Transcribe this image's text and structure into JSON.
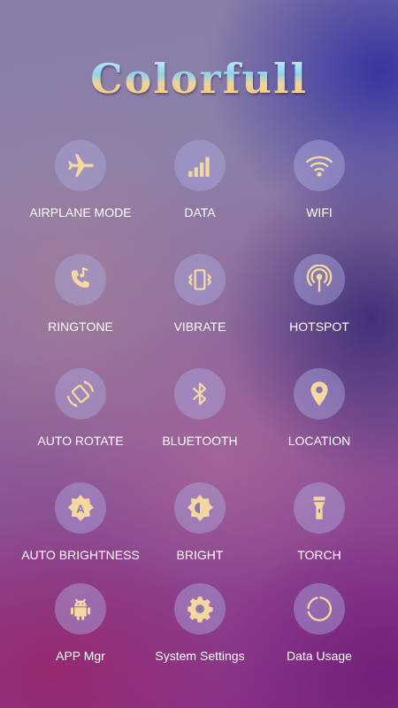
{
  "title": "Colorfull",
  "colors": {
    "icon": "#f5d7a1",
    "circle": "rgba(170,170,225,0.45)",
    "label": "#ffffff"
  },
  "tiles": [
    {
      "label": "AIRPLANE MODE",
      "icon": "airplane-icon"
    },
    {
      "label": "DATA",
      "icon": "signal-bars-icon"
    },
    {
      "label": "WIFI",
      "icon": "wifi-icon"
    },
    {
      "label": "RINGTONE",
      "icon": "ringtone-icon"
    },
    {
      "label": "VIBRATE",
      "icon": "vibrate-icon"
    },
    {
      "label": "HOTSPOT",
      "icon": "hotspot-icon"
    },
    {
      "label": "AUTO ROTATE",
      "icon": "auto-rotate-icon"
    },
    {
      "label": "BLUETOOTH",
      "icon": "bluetooth-icon"
    },
    {
      "label": "LOCATION",
      "icon": "location-pin-icon"
    },
    {
      "label": "AUTO BRIGHTNESS",
      "icon": "auto-brightness-icon"
    },
    {
      "label": "BRIGHT",
      "icon": "brightness-icon"
    },
    {
      "label": "TORCH",
      "icon": "torch-icon"
    },
    {
      "label": "APP Mgr",
      "icon": "android-icon"
    },
    {
      "label": "System Settings",
      "icon": "gear-icon"
    },
    {
      "label": "Data Usage",
      "icon": "data-usage-ring-icon"
    }
  ]
}
